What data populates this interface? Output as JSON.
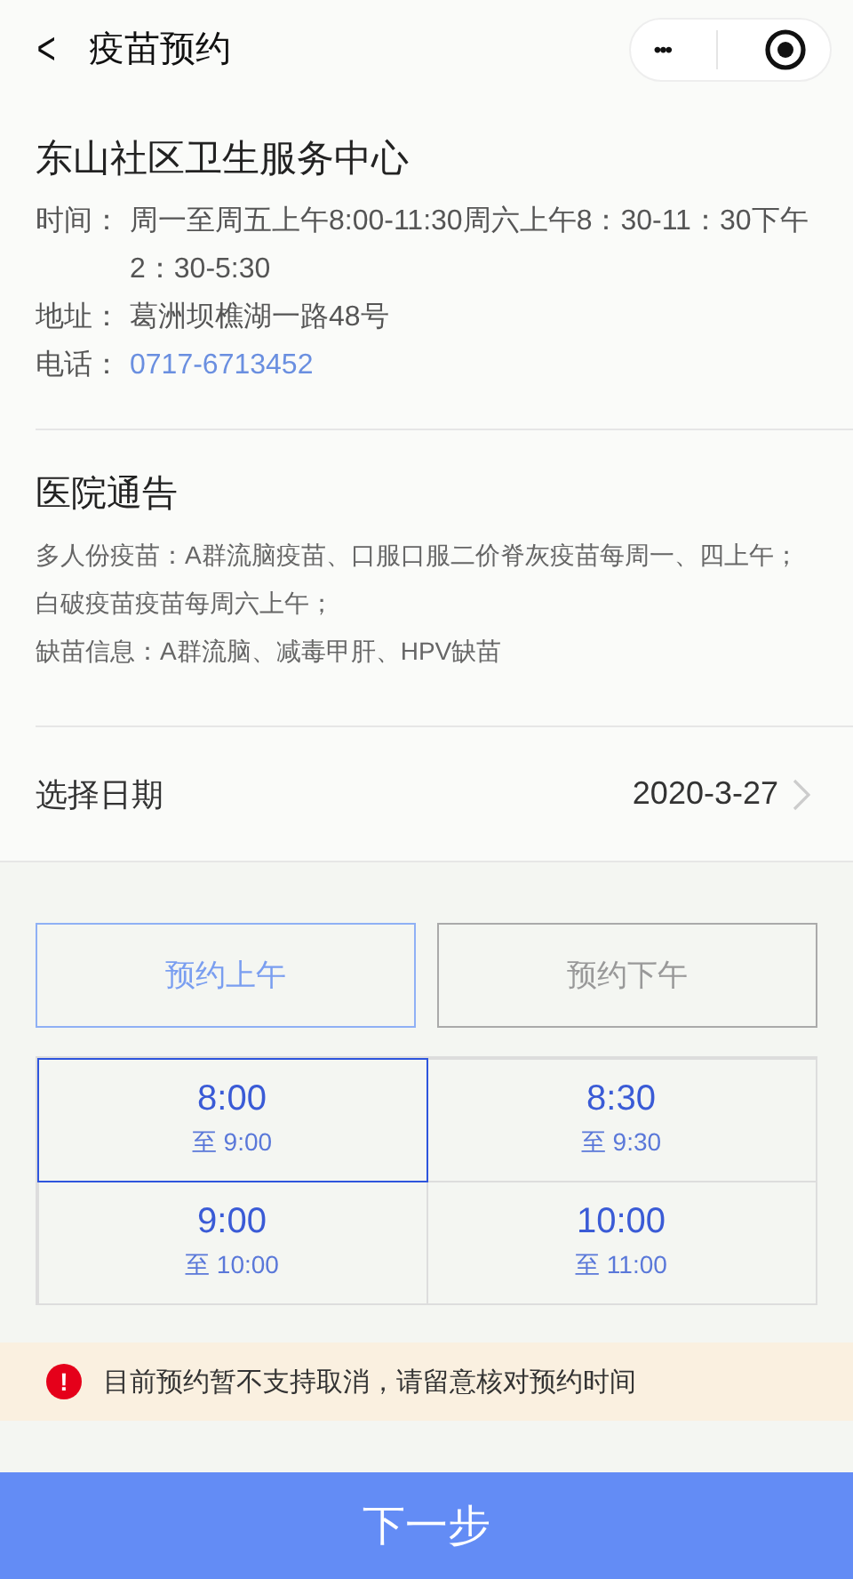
{
  "nav": {
    "back": "<",
    "title": "疫苗预约",
    "more": "•••"
  },
  "clinic": {
    "name": "东山社区卫生服务中心",
    "info": [
      {
        "label": "时间：",
        "value": "周一至周五上午8:00-11:30周六上午8：30-11：30下午2：30-5:30",
        "kind": "text"
      },
      {
        "label": "地址：",
        "value": "葛洲坝樵湖一路48号",
        "kind": "text"
      },
      {
        "label": "电话：",
        "value": "0717-6713452",
        "kind": "link"
      }
    ]
  },
  "notice": {
    "title": "医院通告",
    "lines": [
      "多人份疫苗：A群流脑疫苗、口服口服二价脊灰疫苗每周一、四上午；白破疫苗疫苗每周六上午；",
      "缺苗信息：A群流脑、减毒甲肝、HPV缺苗"
    ]
  },
  "date": {
    "label": "选择日期",
    "value": "2020-3-27"
  },
  "periods": [
    {
      "label": "预约上午",
      "selected": true
    },
    {
      "label": "预约下午",
      "selected": false
    }
  ],
  "slots": [
    {
      "start": "8:00",
      "end": "至 9:00",
      "selected": true
    },
    {
      "start": "8:30",
      "end": "至 9:30",
      "selected": false
    },
    {
      "start": "9:00",
      "end": "至 10:00",
      "selected": false
    },
    {
      "start": "10:00",
      "end": "至 11:00",
      "selected": false
    }
  ],
  "warning": {
    "icon": "!",
    "text": "目前预约暂不支持取消，请留意核对预约时间"
  },
  "next_button": "下一步"
}
